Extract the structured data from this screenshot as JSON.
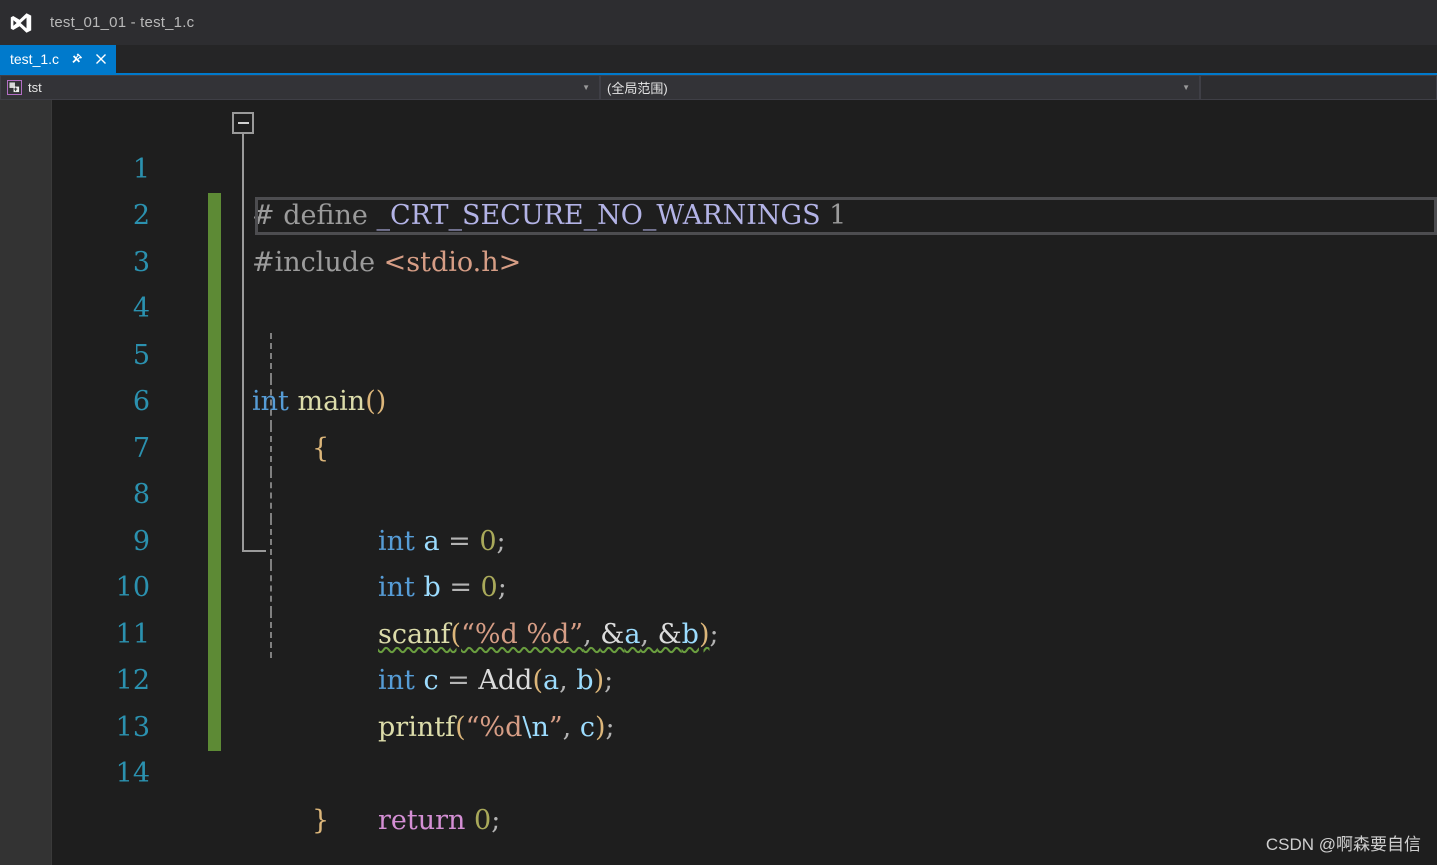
{
  "window": {
    "title": "test_01_01 - test_1.c",
    "logo_icon": "visual-studio-logo-icon"
  },
  "tab": {
    "label": "test_1.c",
    "pin_icon": "pin-icon",
    "close_icon": "close-icon",
    "active_color": "#007acc"
  },
  "navbar": {
    "project_combo": {
      "value": "tst",
      "icon": "project-scope-icon",
      "arrow_icon": "chevron-down-icon"
    },
    "scope_combo": {
      "value": "(全局范围)",
      "arrow_icon": "chevron-down-icon"
    },
    "member_combo": {
      "value": ""
    }
  },
  "editor": {
    "fold_icon": "collapse-minus-icon",
    "current_line": 3,
    "lines": [
      {
        "n": "1",
        "changed": false,
        "indent": false
      },
      {
        "n": "2",
        "changed": false,
        "indent": false
      },
      {
        "n": "3",
        "changed": true,
        "indent": false
      },
      {
        "n": "4",
        "changed": true,
        "indent": false
      },
      {
        "n": "5",
        "changed": true,
        "indent": false
      },
      {
        "n": "6",
        "changed": true,
        "indent": true
      },
      {
        "n": "7",
        "changed": true,
        "indent": true
      },
      {
        "n": "8",
        "changed": true,
        "indent": true
      },
      {
        "n": "9",
        "changed": true,
        "indent": true
      },
      {
        "n": "10",
        "changed": true,
        "indent": true
      },
      {
        "n": "11",
        "changed": true,
        "indent": true
      },
      {
        "n": "12",
        "changed": true,
        "indent": true
      },
      {
        "n": "13",
        "changed": true,
        "indent": false
      },
      {
        "n": "14",
        "changed": true,
        "indent": false
      }
    ],
    "code": {
      "l1_hash": "# define ",
      "l1_macro": "_CRT_SECURE_NO_WARNINGS",
      "l1_value": " 1",
      "l2_include": "#include ",
      "l2_header": "<stdio.h>",
      "l3_text": "",
      "l4_kw": "int",
      "l4_space": " ",
      "l4_name": "main",
      "l4_parens": "()",
      "l5_brace": "{",
      "l6_kw": "int",
      "l6_var": " a ",
      "l6_op": "= ",
      "l6_num": "0",
      "l6_semi": ";",
      "l7_kw": "int",
      "l7_var": " b ",
      "l7_op": "= ",
      "l7_num": "0",
      "l7_semi": ";",
      "l8_func": "scanf",
      "l8_open": "(",
      "l8_str": "“%d %d”",
      "l8_comma1": ", ",
      "l8_amp1": "&",
      "l8_a": "a",
      "l8_comma2": ", ",
      "l8_amp2": "&",
      "l8_b": "b",
      "l8_close": ")",
      "l8_semi": ";",
      "l9_kw": "int",
      "l9_var": " c ",
      "l9_op": "= ",
      "l9_call": "Add",
      "l9_open": "(",
      "l9_a": "a",
      "l9_comma": ", ",
      "l9_b": "b",
      "l9_close": ")",
      "l9_semi": ";",
      "l10_func": "printf",
      "l10_open": "(",
      "l10_str_open": "“%d",
      "l10_esc": "\\n",
      "l10_str_close": "”",
      "l10_comma": ", ",
      "l10_c": "c",
      "l10_close": ")",
      "l10_semi": ";",
      "l11_text": "",
      "l12_kw": "return",
      "l12_space": " ",
      "l12_num": "0",
      "l12_semi": ";",
      "l13_brace": "}",
      "l14_text": ""
    }
  },
  "watermark": {
    "text": "CSDN @啊森要自信"
  }
}
